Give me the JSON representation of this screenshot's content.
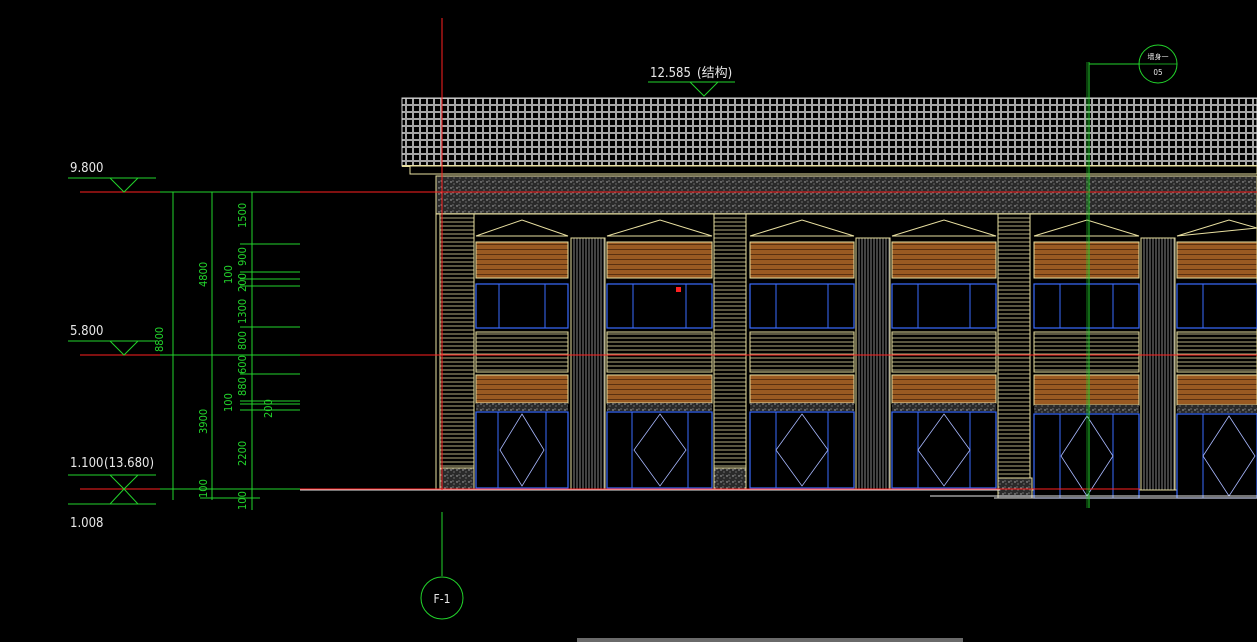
{
  "drawing": {
    "background": "#000000",
    "colors": {
      "red_line": "#ff2020",
      "green_line": "#22d32b",
      "white_text": "#e8e8e8",
      "yellow_line": "#e8dfa0",
      "brown_panel": "#b06a2a",
      "blue_glass": "#3a6cff"
    },
    "roof_level": {
      "elevation": "12.585",
      "note": "(结构)"
    },
    "levels": [
      {
        "label": "9.800"
      },
      {
        "label": "5.800"
      },
      {
        "label": "1.100",
        "alt": "(13.680)"
      },
      {
        "label": "1.008"
      }
    ],
    "dimensions": {
      "overall": "8800",
      "upper": "4800",
      "lower": "3900",
      "base": "100",
      "detail_col1": [
        "1500",
        "900",
        "100",
        "200",
        "1300",
        "800",
        "600",
        "880",
        "100",
        "2200",
        "200",
        "100"
      ]
    },
    "grid_bubbles": [
      {
        "label": "F-1"
      },
      {
        "label": "墙身一",
        "sub": "05"
      }
    ],
    "icons": [
      "level-marker-icon",
      "grid-bubble-icon"
    ]
  }
}
